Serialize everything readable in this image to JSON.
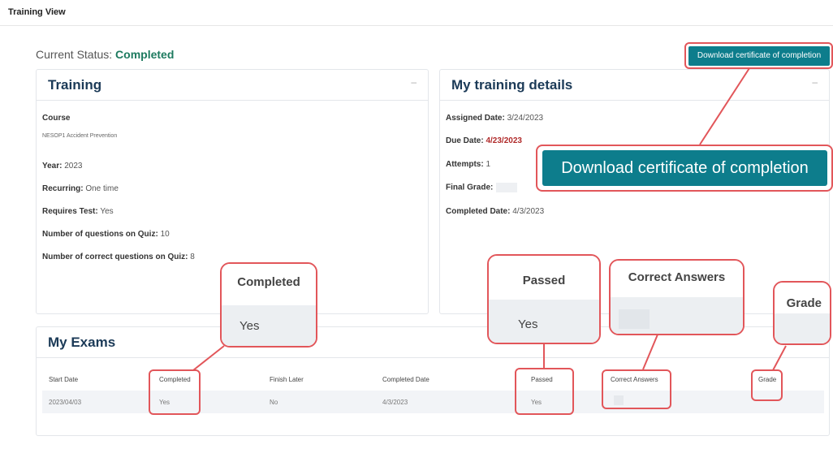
{
  "header": {
    "title": "Training View"
  },
  "status": {
    "label": "Current Status:",
    "value": "Completed"
  },
  "download_button": {
    "label": "Download certificate of completion"
  },
  "training": {
    "title": "Training",
    "minimize": "–",
    "course_label": "Course",
    "course_name": "NESOP1 Accident Prevention",
    "year_label": "Year:",
    "year_value": "2023",
    "recurring_label": "Recurring:",
    "recurring_value": "One time",
    "requires_test_label": "Requires Test:",
    "requires_test_value": "Yes",
    "questions_label": "Number of questions on Quiz:",
    "questions_value": "10",
    "correct_label": "Number of correct questions on Quiz:",
    "correct_value": "8"
  },
  "details": {
    "title": "My training details",
    "minimize": "–",
    "assigned_label": "Assigned Date:",
    "assigned_value": "3/24/2023",
    "due_label": "Due Date:",
    "due_value": "4/23/2023",
    "attempts_label": "Attempts:",
    "attempts_value": "1",
    "final_grade_label": "Final Grade:",
    "completed_label": "Completed Date:",
    "completed_value": "4/3/2023"
  },
  "exams": {
    "title": "My Exams",
    "columns": [
      "Start Date",
      "Completed",
      "Finish Later",
      "Completed Date",
      "Passed",
      "Correct Answers",
      "Grade"
    ],
    "rows": [
      {
        "start_date": "2023/04/03",
        "completed": "Yes",
        "finish_later": "No",
        "completed_date": "4/3/2023",
        "passed": "Yes",
        "correct_answers": "",
        "grade": ""
      }
    ]
  },
  "callouts": {
    "completed": {
      "header": "Completed",
      "value": "Yes"
    },
    "passed": {
      "header": "Passed",
      "value": "Yes"
    },
    "correct_answers": {
      "header": "Correct Answers"
    },
    "grade": {
      "header": "Grade"
    },
    "download": {
      "label": "Download certificate of completion"
    }
  },
  "colors": {
    "accent": "#0d7d8c",
    "status_green": "#1d7a5f",
    "annotation_red": "#e2565a",
    "due_red": "#b02a2a"
  }
}
